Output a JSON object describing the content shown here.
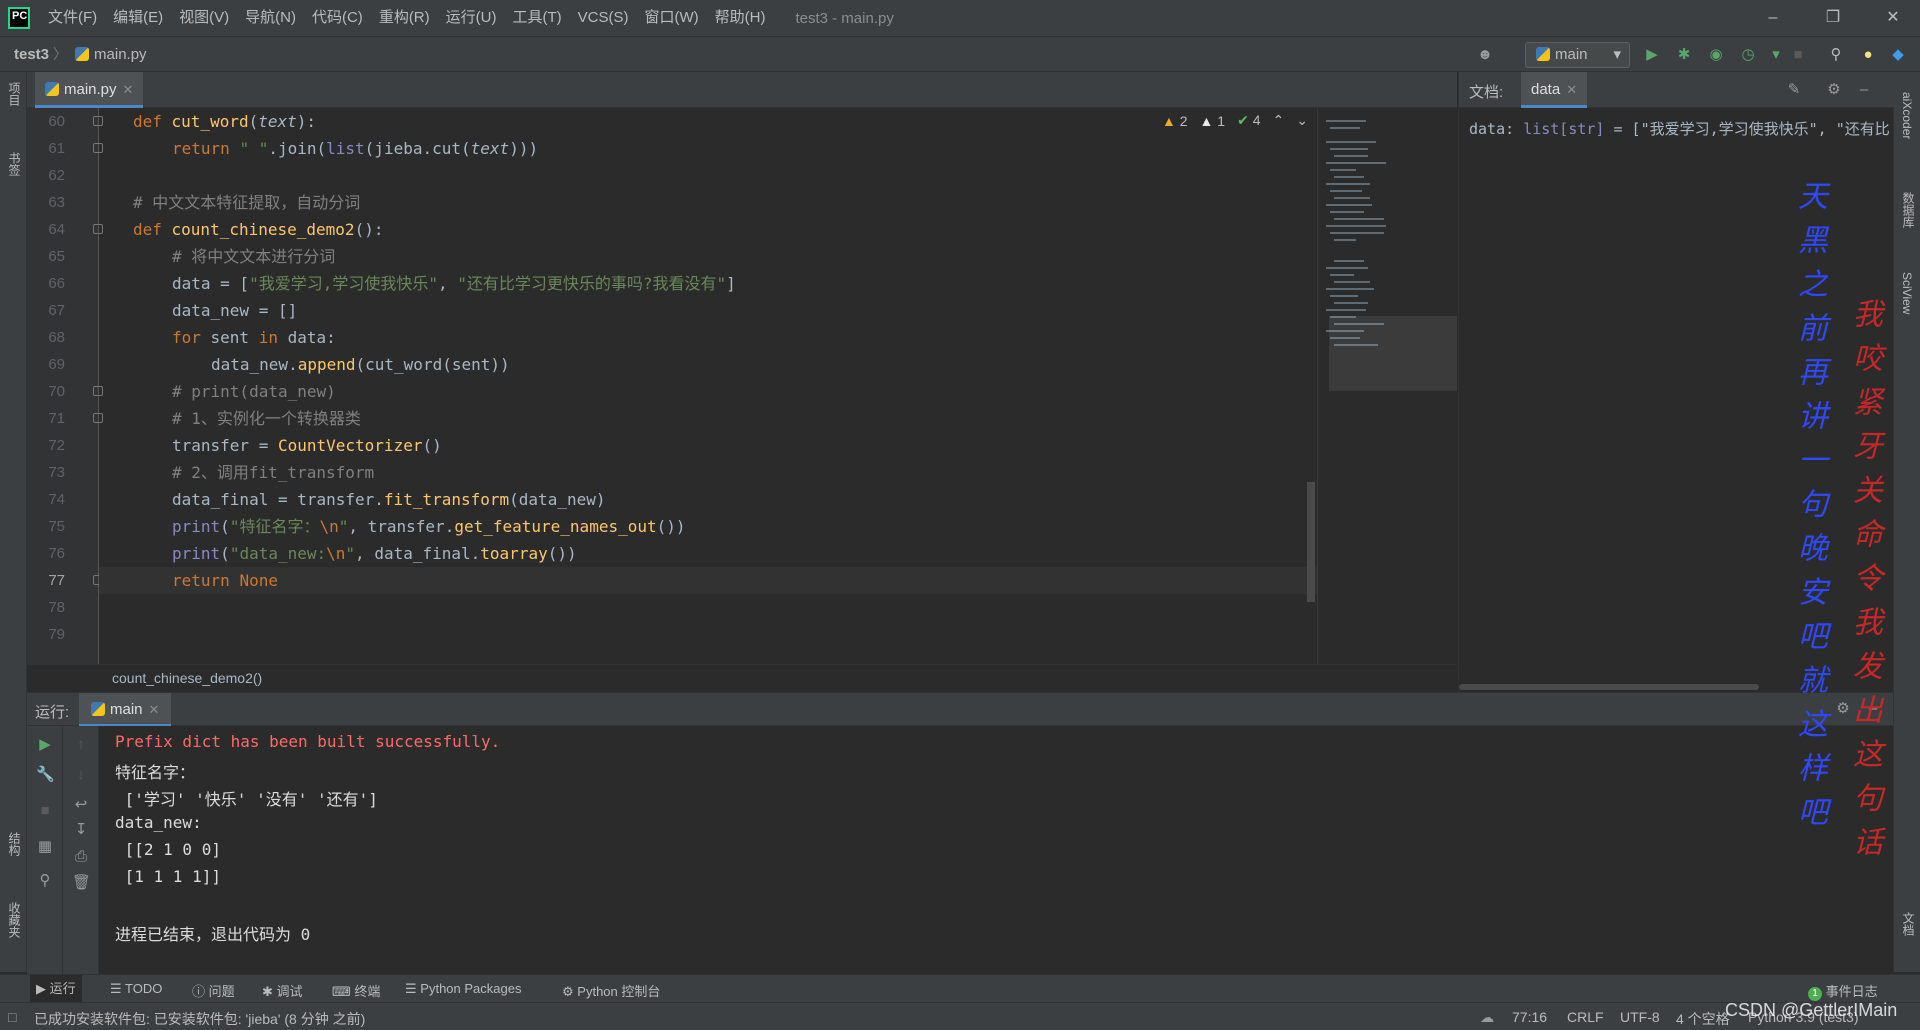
{
  "menubar": {
    "logo_text": "PC",
    "items": [
      "文件(F)",
      "编辑(E)",
      "视图(V)",
      "导航(N)",
      "代码(C)",
      "重构(R)",
      "运行(U)",
      "工具(T)",
      "VCS(S)",
      "窗口(W)",
      "帮助(H)"
    ],
    "window_title": "test3 - main.py"
  },
  "navbar": {
    "project": "test3",
    "file": "main.py",
    "run_config": "main"
  },
  "left_strip": {
    "project": "项目",
    "bookmarks": "书签",
    "structure": "结构",
    "favorites": "收藏夹"
  },
  "right_strip": {
    "aixcoder": "aiXcoder",
    "database": "数据库",
    "sciview": "SciView",
    "doc": "文档"
  },
  "editor": {
    "tab": "main.py",
    "inspections": {
      "warnings": "2",
      "weak_warnings": "1",
      "ok": "4"
    },
    "line_numbers": [
      "60",
      "61",
      "62",
      "63",
      "64",
      "65",
      "66",
      "67",
      "68",
      "69",
      "70",
      "71",
      "72",
      "73",
      "74",
      "75",
      "76",
      "77",
      "78",
      "79"
    ],
    "breadcrumb": "count_chinese_demo2()"
  },
  "code": {
    "l60_def": "def ",
    "l60_fn": "cut_word",
    "l60_open": "(",
    "l60_param": "text",
    "l60_close": "):",
    "l61_ret": "return ",
    "l61_str": "\" \"",
    "l61_join": ".join(",
    "l61_list": "list",
    "l61_a": "(jieba.",
    "l61_cut": "cut",
    "l61_b": "(",
    "l61_param": "text",
    "l61_c": "))) ",
    "l63": "# 中文文本特征提取，自动分词",
    "l64_def": "def ",
    "l64_fn": "count_chinese_demo2",
    "l64_rest": "():",
    "l65": "# 将中文文本进行分词",
    "l66_a": "data = [",
    "l66_s1": "\"我爱学习,学习使我快乐\"",
    "l66_b": ", ",
    "l66_s2": "\"还有比学习更快乐的事吗?我看没有\"",
    "l66_c": "]",
    "l67": "data_new = []",
    "l68_for": "for ",
    "l68_a": "sent ",
    "l68_in": "in ",
    "l68_b": "data:",
    "l69_a": "data_new.",
    "l69_app": "append",
    "l69_b": "(",
    "l69_cw": "cut_word",
    "l69_c": "(sent))",
    "l70": "# print(data_new)",
    "l71": "# 1、实例化一个转换器类",
    "l72_a": "transfer = ",
    "l72_cls": "CountVectorizer",
    "l72_b": "()",
    "l73": "# 2、调用fit_transform",
    "l74_a": "data_final = transfer.",
    "l74_fn": "fit_transform",
    "l74_b": "(data_new)",
    "l75_print": "print",
    "l75_a": "(",
    "l75_s1": "\"特征名字：",
    "l75_esc": "\\n",
    "l75_s2": "\"",
    "l75_b": ", transfer.",
    "l75_fn": "get_feature_names_out",
    "l75_c": "())",
    "l76_print": "print",
    "l76_a": "(",
    "l76_s1": "\"data_new:",
    "l76_esc": "\\n",
    "l76_s2": "\"",
    "l76_b": ", data_final.",
    "l76_fn": "toarray",
    "l76_c": "())",
    "l77_ret": "return ",
    "l77_none": "None"
  },
  "doc_panel": {
    "label": "文档:",
    "tab": "data",
    "content_a": "data: ",
    "content_type": "list[str]",
    "content_b": " = [\"我爱学习,学习使我快乐\", \"还有比"
  },
  "run_panel": {
    "label": "运行:",
    "tab": "main",
    "console": [
      "Prefix dict has been built successfully.",
      "特征名字：",
      " ['学习' '快乐' '没有' '还有']",
      "data_new:",
      " [[2 1 0 0]",
      " [1 1 1 1]]",
      "",
      "进程已结束，退出代码为 0"
    ]
  },
  "bottom_tools": {
    "run": "运行",
    "todo": "TODO",
    "problems": "问题",
    "debug": "调试",
    "terminal": "终端",
    "packages": "Python Packages",
    "console": "Python 控制台",
    "event_log": "事件日志",
    "event_count": "1"
  },
  "statusbar": {
    "message": "已成功安装软件包: 已安装软件包: 'jieba' (8 分钟 之前)",
    "position": "77:16",
    "line_sep": "CRLF",
    "encoding": "UTF-8",
    "indent": "4 个空格",
    "interpreter": "Python 3.9 (test3)"
  },
  "overlay": {
    "col1": "天黑之前再讲一句晚安吧就这样吧",
    "col2": "我咬紧牙关命令我发出这句话",
    "col1_color": "#2e49ff",
    "col2_color": "#c62828",
    "watermark": "CSDN @GettlerIMain"
  },
  "colors": {
    "accent": "#4a88c7",
    "keyword": "#cc7832",
    "string": "#6a8759",
    "function": "#ffc66d",
    "comment": "#808080",
    "error": "#ff6b68"
  }
}
